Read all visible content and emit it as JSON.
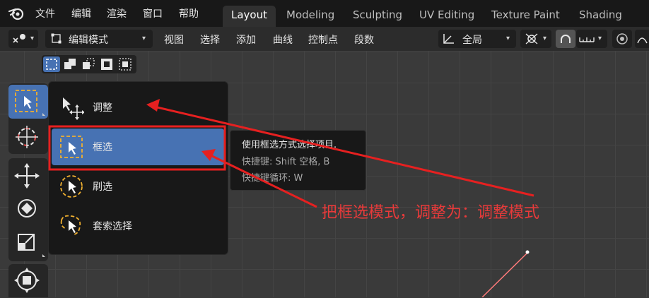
{
  "menubar": {
    "items": [
      "文件",
      "编辑",
      "渲染",
      "窗口",
      "帮助"
    ]
  },
  "workspaces": {
    "tabs": [
      "Layout",
      "Modeling",
      "Sculpting",
      "UV Editing",
      "Texture Paint",
      "Shading"
    ],
    "active": "Layout"
  },
  "header": {
    "mode": "编辑模式",
    "menus": [
      "视图",
      "选择",
      "添加",
      "曲线",
      "控制点",
      "段数"
    ],
    "transform_orientation": "全局"
  },
  "tool_popup": {
    "items": [
      {
        "label": "调整",
        "icon": "tweak-icon"
      },
      {
        "label": "框选",
        "icon": "box-select-icon",
        "active": true
      },
      {
        "label": "刷选",
        "icon": "circle-select-icon"
      },
      {
        "label": "套索选择",
        "icon": "lasso-select-icon"
      }
    ]
  },
  "tooltip": {
    "line1": "使用框选方式选择项目.",
    "line2": "快捷键: Shift 空格, B",
    "line3": "快捷键循环: W"
  },
  "annotation": {
    "text": "把框选模式，调整为：调整模式",
    "color": "#e83a3a"
  },
  "colors": {
    "accent": "#4772b3",
    "annotation": "#e83a3a"
  }
}
